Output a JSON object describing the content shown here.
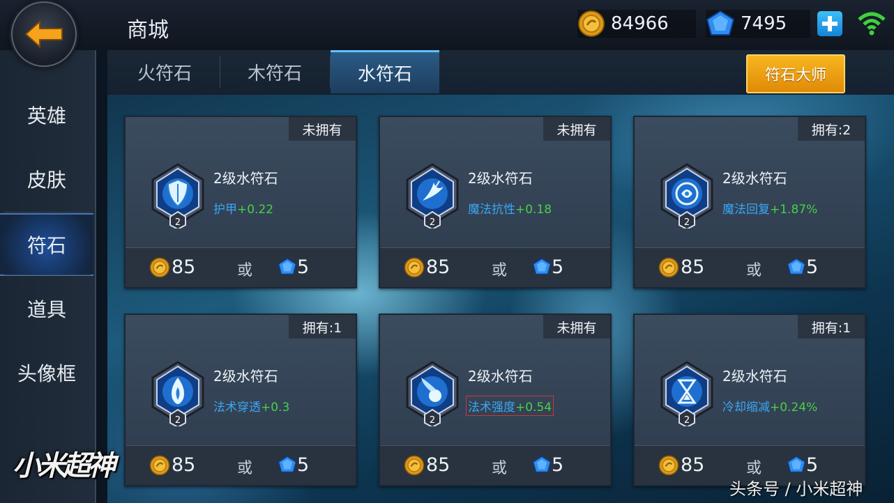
{
  "header": {
    "title": "商城",
    "gold": "84966",
    "gems": "7495"
  },
  "sidebar": {
    "items": [
      {
        "label": "英雄"
      },
      {
        "label": "皮肤"
      },
      {
        "label": "符石"
      },
      {
        "label": "道具"
      },
      {
        "label": "头像框"
      }
    ]
  },
  "tabs": [
    {
      "label": "火符石"
    },
    {
      "label": "木符石"
    },
    {
      "label": "水符石"
    }
  ],
  "master_button": "符石大师",
  "cards": [
    {
      "ownership": "未拥有",
      "name": "2级水符石",
      "stat_label": "护甲",
      "stat_value": "+0.22",
      "level": "2",
      "gold_price": "85",
      "or": "或",
      "gem_price": "5",
      "icon": "shield"
    },
    {
      "ownership": "未拥有",
      "name": "2级水符石",
      "stat_label": "魔法抗性",
      "stat_value": "+0.18",
      "level": "2",
      "gold_price": "85",
      "or": "或",
      "gem_price": "5",
      "icon": "bird"
    },
    {
      "ownership": "拥有:2",
      "name": "2级水符石",
      "stat_label": "魔法回复",
      "stat_value": "+1.87%",
      "level": "2",
      "gold_price": "85",
      "or": "或",
      "gem_price": "5",
      "icon": "swirl"
    },
    {
      "ownership": "拥有:1",
      "name": "2级水符石",
      "stat_label": "法术穿透",
      "stat_value": "+0.3",
      "level": "2",
      "gold_price": "85",
      "or": "或",
      "gem_price": "5",
      "icon": "flame"
    },
    {
      "ownership": "未拥有",
      "name": "2级水符石",
      "stat_label": "法术强度",
      "stat_value": "+0.54",
      "level": "2",
      "gold_price": "85",
      "or": "或",
      "gem_price": "5",
      "icon": "comet"
    },
    {
      "ownership": "拥有:1",
      "name": "2级水符石",
      "stat_label": "冷却缩减",
      "stat_value": "+0.24%",
      "level": "2",
      "gold_price": "85",
      "or": "或",
      "gem_price": "5",
      "icon": "hourglass"
    }
  ],
  "logo": "小米超神",
  "watermark": "头条号 / 小米超神"
}
